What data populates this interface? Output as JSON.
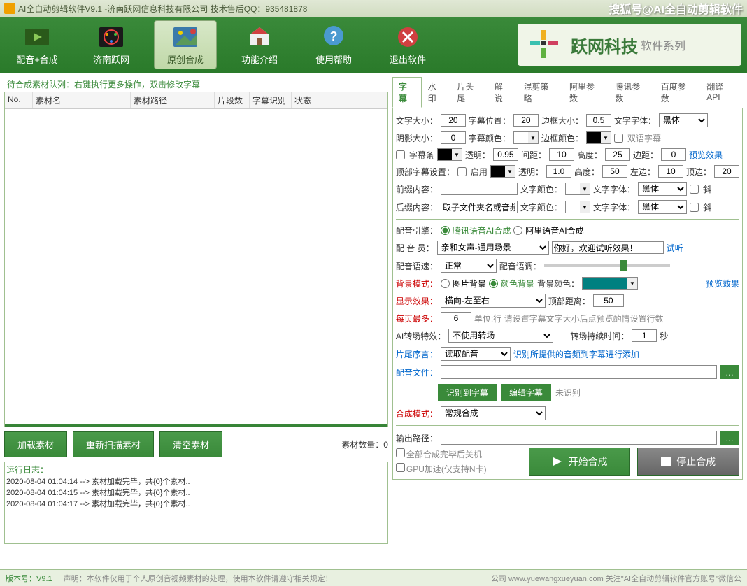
{
  "titlebar": {
    "title": "AI全自动剪辑软件V9.1 -济南跃网信息科技有限公司 技术售后QQ：935481878",
    "brand": "搜狐号@AI全自动剪辑软件"
  },
  "toolbar": {
    "btn1": "配音+合成",
    "btn2": "济南跃网",
    "btn3": "原创合成",
    "btn4": "功能介绍",
    "btn5": "使用帮助",
    "btn6": "退出软件",
    "logo_main": "跃网科技",
    "logo_sub": "软件系列"
  },
  "queue": {
    "label": "待合成素材队列：右键执行更多操作，双击修改字幕",
    "cols": {
      "no": "No.",
      "name": "素材名",
      "path": "素材路径",
      "seg": "片段数",
      "recog": "字幕识别",
      "status": "状态"
    },
    "btn_load": "加载素材",
    "btn_rescan": "重新扫描素材",
    "btn_clear": "清空素材",
    "count": "素材数量：0"
  },
  "log": {
    "title": "运行日志：",
    "lines": [
      "2020-08-04 01:04:14 --> 素材加载完毕，共{0}个素材..",
      "2020-08-04 01:04:15 --> 素材加载完毕，共{0}个素材..",
      "2020-08-04 01:04:17 --> 素材加载完毕，共{0}个素材.."
    ]
  },
  "tabs": [
    "字幕",
    "水印",
    "片头尾",
    "解说",
    "混剪策略",
    "阿里参数",
    "腾讯参数",
    "百度参数",
    "翻译API"
  ],
  "settings": {
    "row1": {
      "l1": "文字大小：",
      "v1": "20",
      "l2": "字幕位置：",
      "v2": "20",
      "l3": "边框大小：",
      "v3": "0.5",
      "l4": "文字字体：",
      "sel": "黑体"
    },
    "row2": {
      "l1": "阴影大小：",
      "v1": "0",
      "l2": "字幕颜色：",
      "l3": "边框颜色：",
      "chk": "双语字幕"
    },
    "row3": {
      "chk": "字幕条",
      "l2": "透明：",
      "v2": "0.95",
      "l3": "间距：",
      "v3": "10",
      "l4": "高度：",
      "v4": "25",
      "l5": "边距：",
      "v5": "0",
      "link": "预览效果"
    },
    "row4": {
      "l1": "顶部字幕设置：",
      "chk": "启用",
      "l2": "透明：",
      "v2": "1.0",
      "l3": "高度：",
      "v3": "50",
      "l4": "左边：",
      "v4": "10",
      "l5": "顶边：",
      "v5": "20"
    },
    "row5": {
      "l1": "前缀内容：",
      "v1": "",
      "l2": "文字颜色：",
      "l3": "文字字体：",
      "sel": "黑体",
      "chk": "斜"
    },
    "row6": {
      "l1": "后缀内容：",
      "v1": "取子文件夹名或音频",
      "l2": "文字颜色：",
      "l3": "文字字体：",
      "sel": "黑体",
      "chk": "斜"
    },
    "voice_engine": {
      "lbl": "配音引擎：",
      "r1": "腾讯语音AI合成",
      "r2": "阿里语音AI合成"
    },
    "voice_member": {
      "lbl": "配 音 员：",
      "sel": "亲和女声-通用场景",
      "inp": "你好，欢迎试听效果！",
      "link": "试听"
    },
    "voice_speed": {
      "lbl": "配音语速：",
      "sel": "正常",
      "tone": "配音语调："
    },
    "bg_mode": {
      "lbl": "背景模式：",
      "r1": "图片背景",
      "r2": "颜色背景",
      "color_lbl": "背景颜色：",
      "link": "预览效果"
    },
    "display": {
      "lbl": "显示效果：",
      "sel": "横向-左至右",
      "l2": "顶部距离：",
      "v2": "50"
    },
    "per_page": {
      "lbl": "每页最多：",
      "v": "6",
      "hint": "单位:行 请设置字幕文字大小后点预览酌情设置行数"
    },
    "transition": {
      "lbl": "AI转场特效：",
      "sel": "不使用转场",
      "l2": "转场持续时间：",
      "v2": "1",
      "unit": "秒"
    },
    "prologue": {
      "lbl": "片尾序言：",
      "sel": "读取配音",
      "hint": "识别所提供的音频到字幕进行添加"
    },
    "audio_file": {
      "lbl": "配音文件："
    },
    "btn_recog": "识别到字幕",
    "btn_edit": "编辑字幕",
    "not_recog": "未识别",
    "compose_mode": {
      "lbl": "合成模式：",
      "sel": "常规合成"
    },
    "output": {
      "lbl": "输出路径："
    },
    "chk_shutdown": "全部合成完毕后关机",
    "chk_gpu": "GPU加速(仅支持N卡)",
    "btn_start": "开始合成",
    "btn_stop": "停止合成"
  },
  "statusbar": {
    "ver": "版本号：V9.1",
    "decl": "声明：本软件仅用于个人原创音视频素材的处理，使用本软件请遵守相关规定！",
    "co": "公司 www.yuewangxueyuan.com 关注\"AI全自动剪辑软件官方账号\"微信公"
  }
}
